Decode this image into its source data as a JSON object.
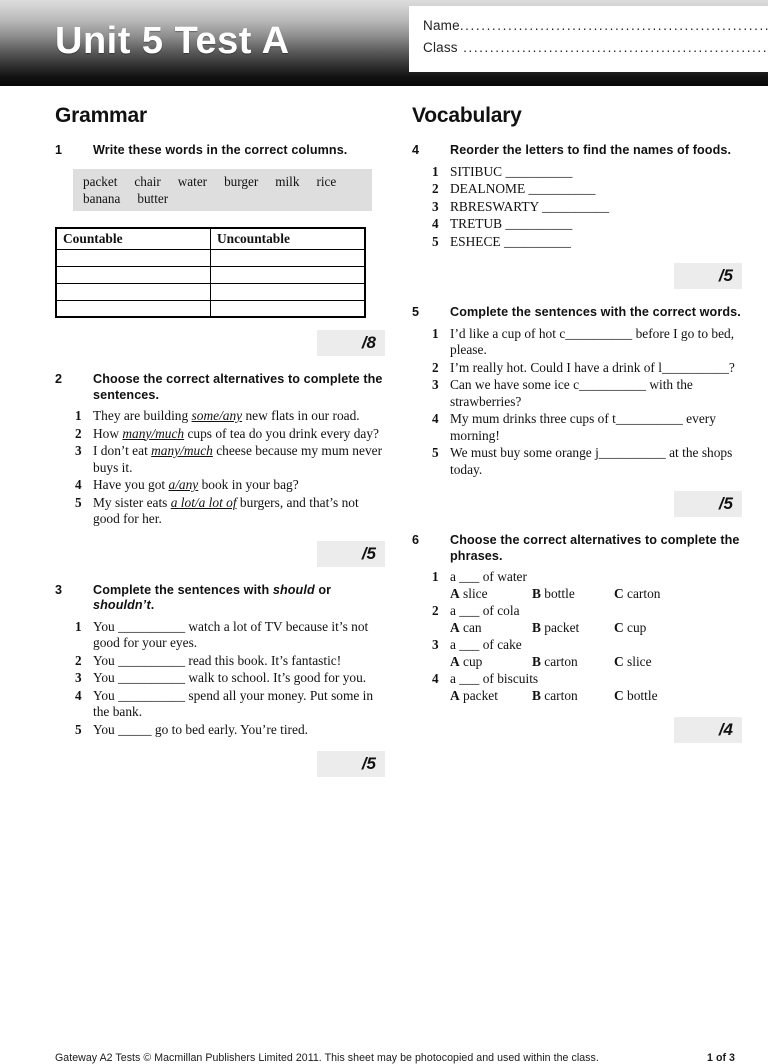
{
  "header": {
    "title": "Unit 5 Test A",
    "name_label": "Name",
    "class_label": "Class",
    "name_dots": "........................................................................",
    "class_dots": " ......................................................................."
  },
  "columns": {
    "left_heading": "Grammar",
    "right_heading": "Vocabulary"
  },
  "exercises": [
    {
      "number": "1",
      "instruction_parts": [
        "Write these words in the correct columns."
      ],
      "wordbox": [
        "packet",
        "chair",
        "water",
        "burger",
        "milk",
        "rice",
        "banana",
        "butter"
      ],
      "table": {
        "headers": [
          "Countable",
          "Uncountable"
        ],
        "empty_rows": 4
      },
      "score": "/8"
    },
    {
      "number": "2",
      "instruction": "Choose the correct alternatives to complete the sentences.",
      "items": [
        {
          "num": "1",
          "pre": "They are building ",
          "alt": "some/any",
          "post": " new flats in our road."
        },
        {
          "num": "2",
          "pre": "How ",
          "alt": "many/much",
          "post": " cups of tea do you drink every day?"
        },
        {
          "num": "3",
          "pre": "I don’t eat ",
          "alt": "many/much",
          "post": " cheese because my mum never buys it."
        },
        {
          "num": "4",
          "pre": "Have you got ",
          "alt": "a/any",
          "post": " book in your bag?"
        },
        {
          "num": "5",
          "pre": "My sister eats ",
          "alt": "a lot/a lot of",
          "post": " burgers, and that’s not good for her."
        }
      ],
      "score": "/5"
    },
    {
      "number": "3",
      "instruction_pre": "Complete the sentences with ",
      "instruction_em1": "should",
      "instruction_mid": " or ",
      "instruction_em2": "shouldn’t",
      "instruction_post": ".",
      "items": [
        {
          "num": "1",
          "pre": "You ",
          "blank": "__________",
          "post": " watch a lot of TV because it’s not good for your eyes."
        },
        {
          "num": "2",
          "pre": "You ",
          "blank": "__________",
          "post": " read this book. It’s fantastic!"
        },
        {
          "num": "3",
          "pre": "You ",
          "blank": "__________",
          "post": " walk to school. It’s good for you."
        },
        {
          "num": "4",
          "pre": "You ",
          "blank": "__________",
          "post": " spend all your money. Put some in the bank."
        },
        {
          "num": "5",
          "pre": "You ",
          "blank": "_____",
          "post": " go to bed early. You’re tired."
        }
      ],
      "score": "/5"
    },
    {
      "number": "4",
      "instruction": "Reorder the letters to find the names of foods.",
      "items": [
        {
          "num": "1",
          "pre": "SITIBUC ",
          "blank": "__________",
          "post": ""
        },
        {
          "num": "2",
          "pre": "DEALNOME ",
          "blank": "__________",
          "post": ""
        },
        {
          "num": "3",
          "pre": "RBRESWARTY ",
          "blank": "__________",
          "post": ""
        },
        {
          "num": "4",
          "pre": "TRETUB ",
          "blank": "__________",
          "post": ""
        },
        {
          "num": "5",
          "pre": "ESHECE ",
          "blank": "__________",
          "post": ""
        }
      ],
      "score": "/5"
    },
    {
      "number": "5",
      "instruction": "Complete the sentences with the correct words.",
      "items": [
        {
          "num": "1",
          "pre": "I’d like a cup of hot c",
          "blank": "__________",
          "post": " before I go to bed, please."
        },
        {
          "num": "2",
          "pre": "I’m really hot. Could I have a drink of l",
          "blank": "__________",
          "post": "?"
        },
        {
          "num": "3",
          "pre": "Can we have some ice c",
          "blank": "__________",
          "post": " with the strawberries?"
        },
        {
          "num": "4",
          "pre": "My mum drinks three cups of t",
          "blank": "__________",
          "post": " every morning!"
        },
        {
          "num": "5",
          "pre": "We must buy some orange j",
          "blank": "__________",
          "post": " at the shops today."
        }
      ],
      "score": "/5"
    },
    {
      "number": "6",
      "instruction": "Choose the correct alternatives to complete the phrases.",
      "items": [
        {
          "num": "1",
          "phrase": "a ___ of water",
          "options": [
            "A slice",
            "B bottle",
            "C carton"
          ]
        },
        {
          "num": "2",
          "phrase": "a ___ of cola",
          "options": [
            "A can",
            "B packet",
            "C cup"
          ]
        },
        {
          "num": "3",
          "phrase": "a ___ of cake",
          "options": [
            "A cup",
            "B carton",
            "C slice"
          ]
        },
        {
          "num": "4",
          "phrase": "a ___ of biscuits",
          "options": [
            "A packet",
            "B carton",
            "C bottle"
          ]
        }
      ],
      "score": "/4"
    }
  ],
  "footer": {
    "text": "Gateway A2 Tests © Macmillan Publishers Limited 2011. This sheet may be photocopied and used within the class.",
    "page": "1 of 3"
  }
}
